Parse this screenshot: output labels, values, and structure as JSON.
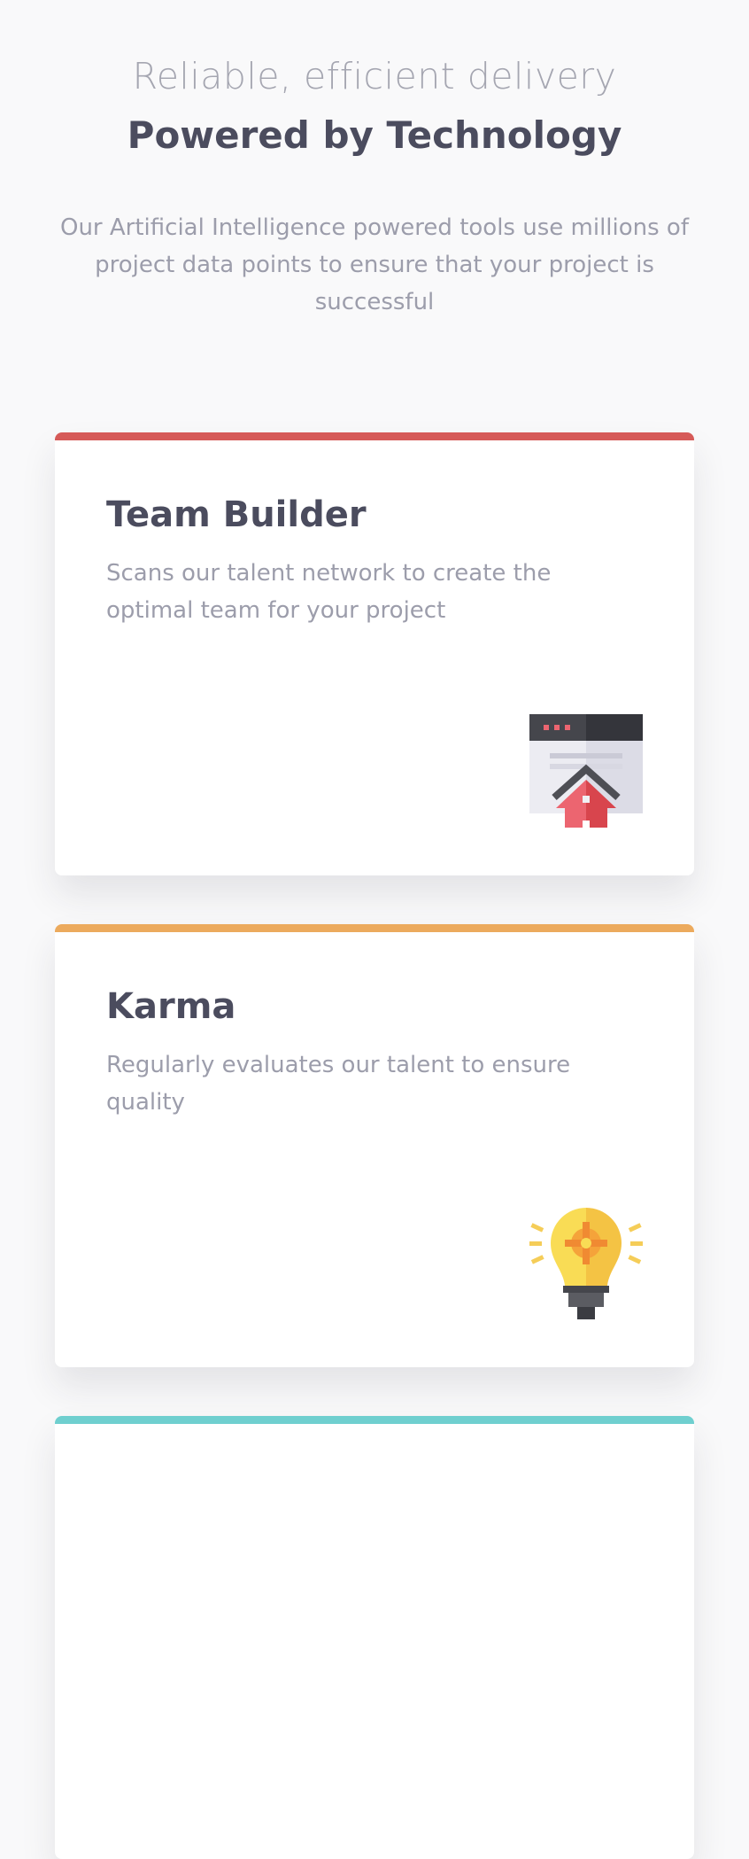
{
  "header": {
    "subtitle": "Reliable, efficient delivery",
    "title": "Powered by Technology",
    "intro": "Our Artificial Intelligence powered tools use millions of project data points to ensure that your project is successful"
  },
  "cards": [
    {
      "title": "Team Builder",
      "description": "Scans our talent network to create the optimal team for your project",
      "accent_color": "#d65a58",
      "icon": "browser-house-icon"
    },
    {
      "title": "Karma",
      "description": "Regularly evaluates our talent to ensure quality",
      "accent_color": "#ecaa5d",
      "icon": "lightbulb-gear-icon"
    },
    {
      "title": "",
      "description": "",
      "accent_color": "#6fcfcf",
      "icon": ""
    }
  ]
}
